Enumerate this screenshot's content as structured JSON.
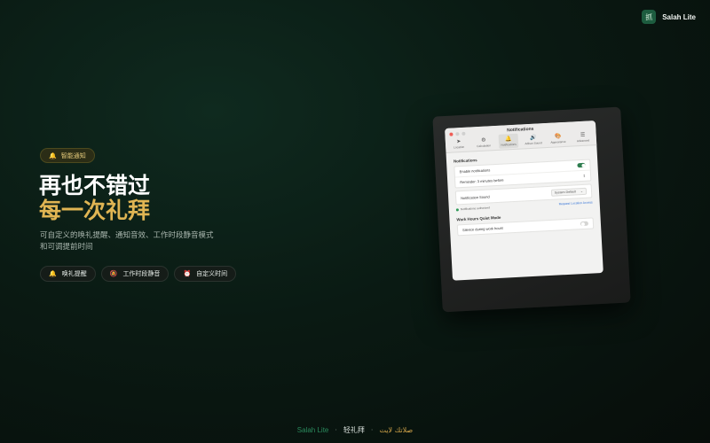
{
  "brand": {
    "logo_glyph": "抓",
    "name": "Salah Lite"
  },
  "badge": {
    "icon": "bell-icon",
    "label": "智能通知"
  },
  "headline": {
    "line1": "再也不错过",
    "line2": "每一次礼拜"
  },
  "subtitle": {
    "line1": "可自定义的唤礼提醒、通知音效、工作时段静音模式",
    "line2": "和可调提前时间"
  },
  "chips": [
    {
      "icon": "bell-icon",
      "label": "唤礼提醒"
    },
    {
      "icon": "bell-off-icon",
      "label": "工作时段静音"
    },
    {
      "icon": "alarm-clock-icon",
      "label": "自定义时间"
    }
  ],
  "window": {
    "title": "Notifications",
    "tabs": [
      {
        "icon": "location-arrow-icon",
        "label": "Location"
      },
      {
        "icon": "gear-icon",
        "label": "Calculation"
      },
      {
        "icon": "bell-icon",
        "label": "Notifications"
      },
      {
        "icon": "speaker-icon",
        "label": "Adhan Sound"
      },
      {
        "icon": "palette-icon",
        "label": "Appearance"
      },
      {
        "icon": "list-icon",
        "label": "Advanced"
      }
    ],
    "notifications": {
      "section_title": "Notifications",
      "enable_label": "Enable notifications",
      "reminder_label": "Reminder: 3 minutes before",
      "sound_label": "Notification Sound",
      "sound_value": "System Default",
      "status_text": "Notifications authorized",
      "request_link": "Request Location Access"
    },
    "quiet": {
      "section_title": "Work Hours Quiet Mode",
      "silence_label": "Silence during work hours"
    }
  },
  "footer": {
    "en": "Salah Lite",
    "cn": "轻礼拜",
    "ar": "صلاتك لايت",
    "separator": "·"
  }
}
